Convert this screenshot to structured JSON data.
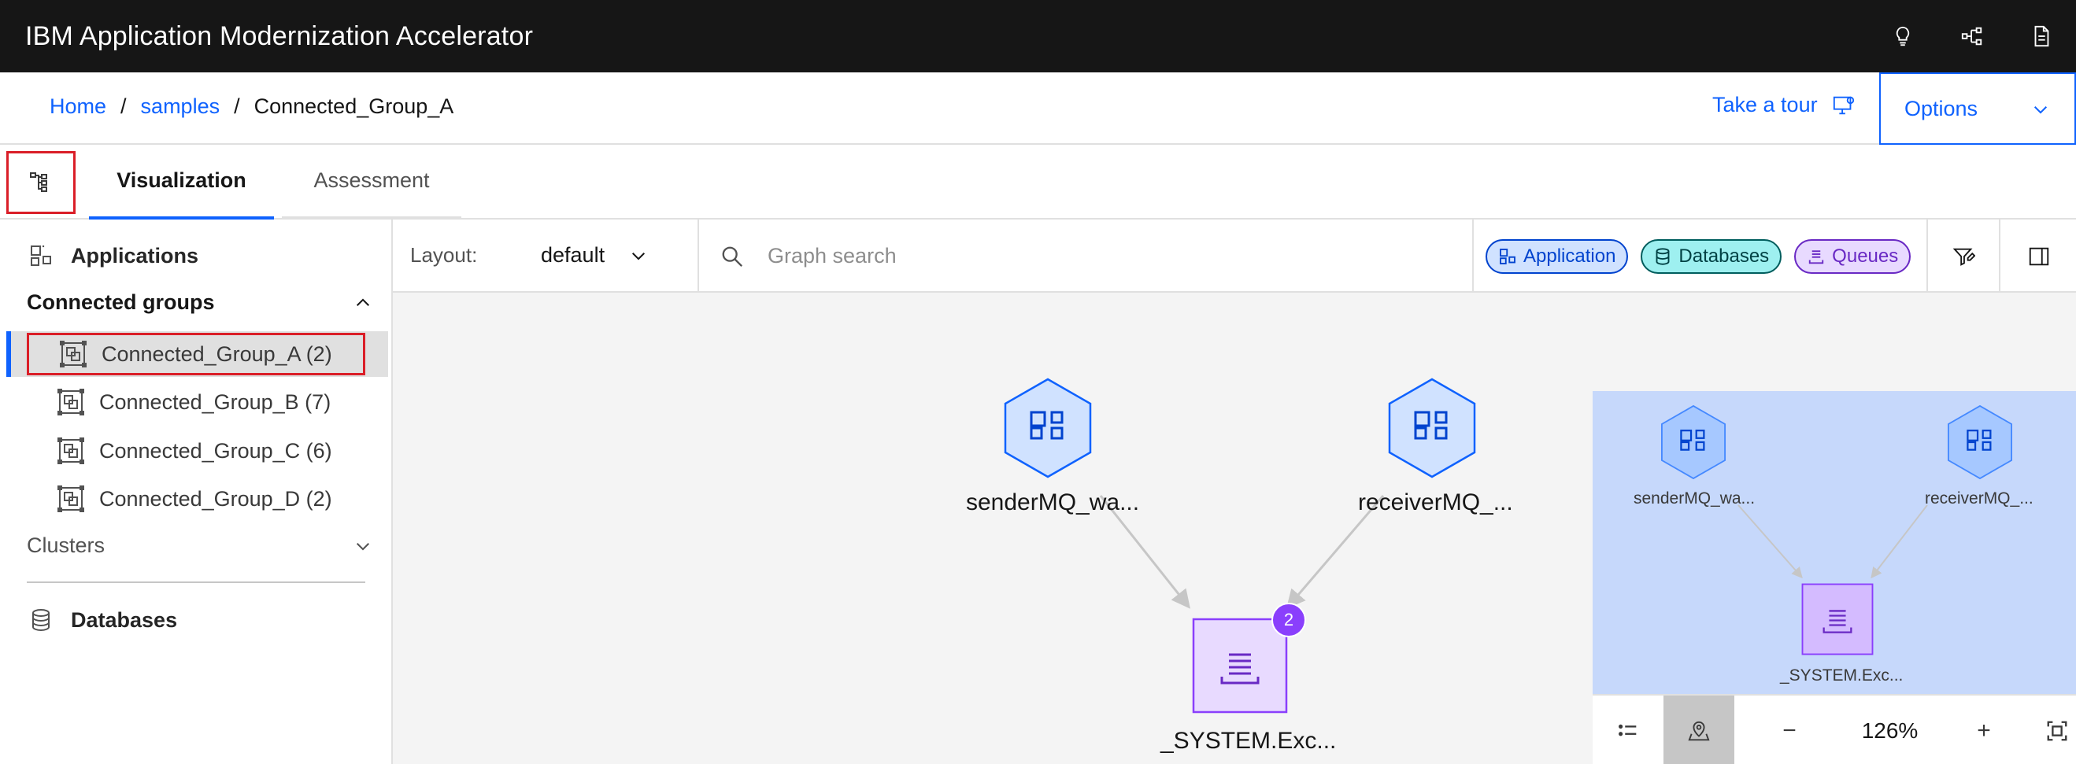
{
  "header": {
    "title": "IBM Application Modernization Accelerator"
  },
  "breadcrumb": {
    "home": "Home",
    "samples": "samples",
    "current": "Connected_Group_A",
    "separator": "/"
  },
  "tour": {
    "label": "Take a tour"
  },
  "options": {
    "label": "Options"
  },
  "tabs": {
    "visualization": "Visualization",
    "assessment": "Assessment"
  },
  "sidebar": {
    "applications": "Applications",
    "connected_groups": "Connected groups",
    "groups": [
      "Connected_Group_A (2)",
      "Connected_Group_B (7)",
      "Connected_Group_C (6)",
      "Connected_Group_D (2)"
    ],
    "clusters": "Clusters",
    "databases": "Databases"
  },
  "toolbar": {
    "layout_label": "Layout:",
    "layout_value": "default",
    "search_placeholder": "Graph search",
    "chips": {
      "application": "Application",
      "databases": "Databases",
      "queues": "Queues"
    }
  },
  "graph": {
    "nodes": {
      "sender": "senderMQ_wa...",
      "receiver": "receiverMQ_...",
      "queue": "_SYSTEM.Exc..."
    },
    "badge": "2"
  },
  "minimap": {
    "sender": "senderMQ_wa...",
    "receiver": "receiverMQ_...",
    "queue": "_SYSTEM.Exc...",
    "zoom": "126%",
    "zoom_out": "−",
    "zoom_in": "+"
  },
  "colors": {
    "brand_blue": "#0f62fe",
    "highlight_red": "#da1e28",
    "queue_purple": "#8a3ffc",
    "app_blue": "#d0e2ff"
  }
}
